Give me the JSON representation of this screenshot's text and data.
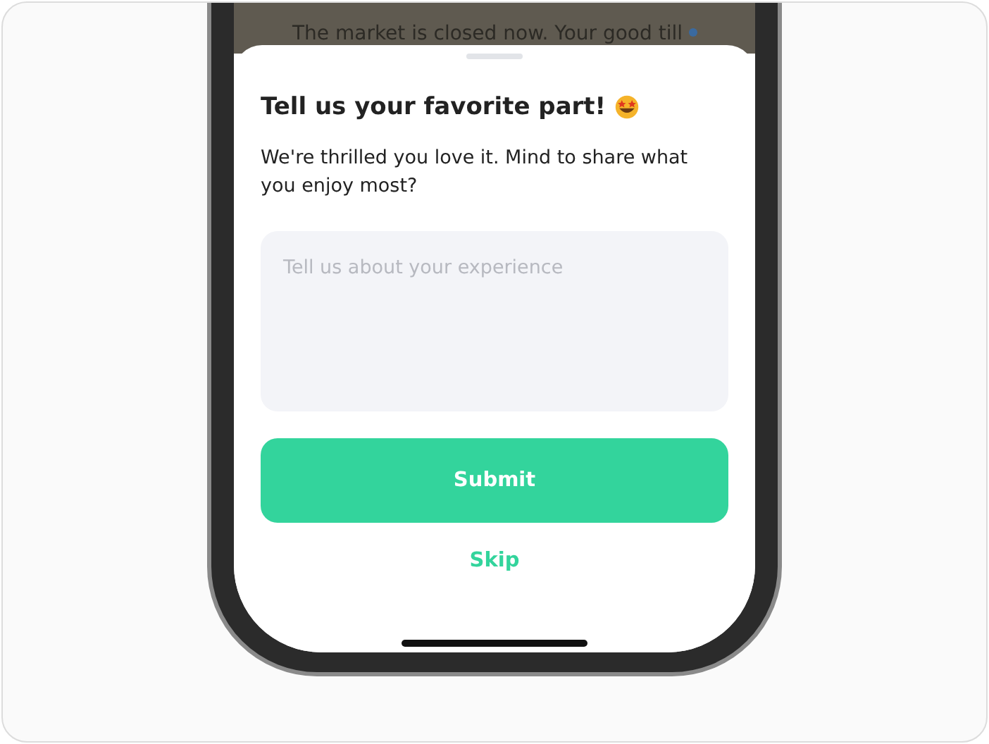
{
  "background_notice": "The market is closed now. Your good till",
  "sheet": {
    "title": "Tell us your favorite part!",
    "message": "We're thrilled you love it. Mind to share what you enjoy most?",
    "feedback_field": {
      "placeholder": "Tell us about your experience"
    },
    "submit_button": "Submit",
    "skip_link": "Skip"
  }
}
